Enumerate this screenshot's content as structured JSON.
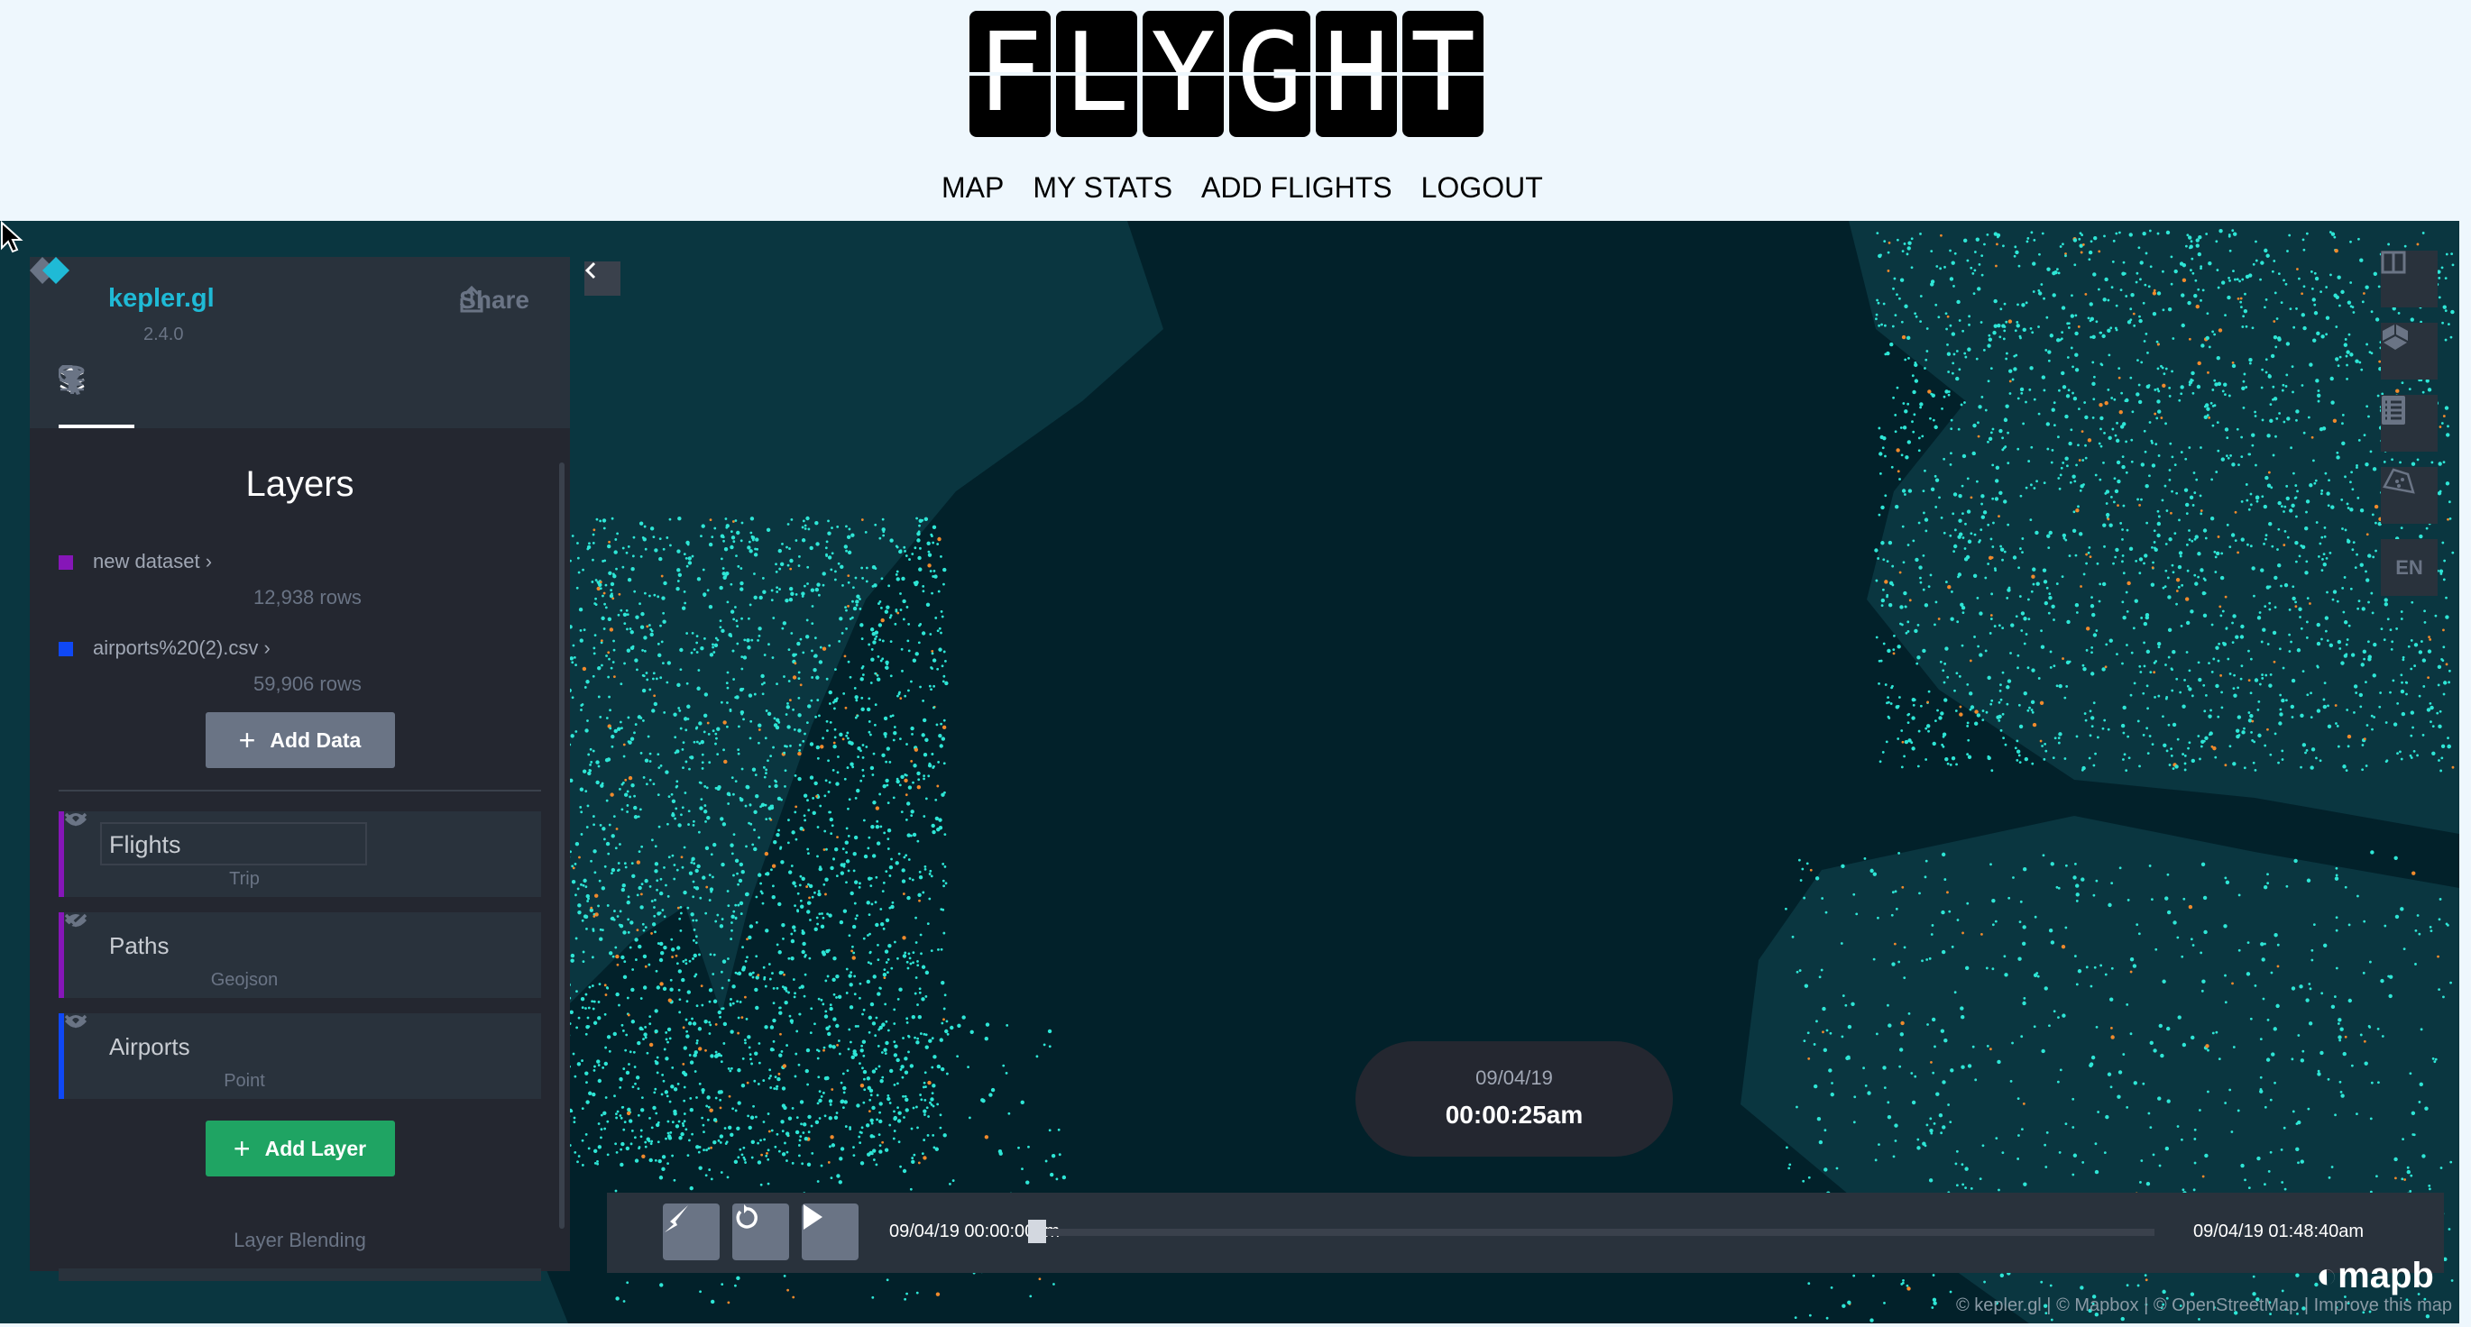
{
  "header": {
    "logo_text": "FLYGHT",
    "nav": [
      "MAP",
      "MY STATS",
      "ADD FLIGHTS",
      "LOGOUT"
    ]
  },
  "panel": {
    "app_name": "kepler.gl",
    "version": "2.4.0",
    "share_label": "Share",
    "tabs": [
      "layers-icon",
      "filter-icon",
      "interaction-icon",
      "map-settings-icon"
    ],
    "title": "Layers",
    "datasets": [
      {
        "name": "new dataset",
        "rows": "12,938 rows",
        "color": "#8616b8"
      },
      {
        "name": "airports%20(2).csv",
        "rows": "59,906 rows",
        "color": "#0f48f5"
      }
    ],
    "add_data_label": "Add Data",
    "layers": [
      {
        "name": "Flights",
        "type": "Trip",
        "color": "#8616b8",
        "visible": true,
        "editing": true
      },
      {
        "name": "Paths",
        "type": "Geojson",
        "color": "#8616b8",
        "visible": false
      },
      {
        "name": "Airports",
        "type": "Point",
        "color": "#0f48f5",
        "visible": true
      }
    ],
    "add_layer_label": "Add Layer",
    "blending_label": "Layer Blending"
  },
  "map_controls": {
    "items": [
      "split-map-icon",
      "3d-view-icon",
      "legend-icon",
      "draw-polygon-icon"
    ],
    "locale": "EN"
  },
  "time_display": {
    "date": "09/04/19",
    "time": "00:00:25am"
  },
  "timeline": {
    "start": "09/04/19 00:00:00am",
    "end": "09/04/19 01:48:40am",
    "progress": 0.004
  },
  "attribution": "© kepler.gl | © Mapbox | © OpenStreetMap | Improve this map",
  "mapbox_logo": "mapbox",
  "colors": {
    "accent": "#1fbad6",
    "add_layer": "#1fa463",
    "add_data": "#6a7485",
    "sea": "#02212a",
    "land": "#0a3640",
    "dots": "#2ee6d6",
    "dots2": "#f08a2c"
  }
}
